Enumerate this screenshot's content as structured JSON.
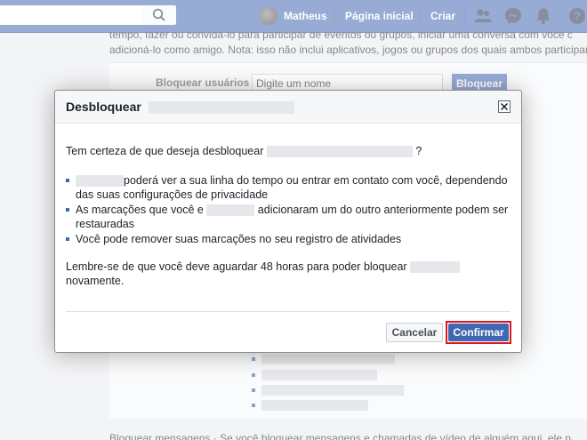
{
  "topbar": {
    "user_name": "Matheus",
    "home_label": "Página inicial",
    "create_label": "Criar"
  },
  "background": {
    "text_line_1": "tempo, fazer ou convidá-lo para participar de eventos ou grupos, iniciar uma conversa com você ou",
    "text_line_2": "adicioná-lo como amigo. Nota: isso não inclui aplicativos, jogos ou grupos dos quais ambos participam.",
    "block_users_label": "Bloquear usuários",
    "block_input_placeholder": "Digite um nome",
    "block_button_label": "Bloquear",
    "bottom_text": "Bloquear mensagens · Se você bloquear mensagens e chamadas de vídeo de alguém aqui, ele não poderá"
  },
  "dialog": {
    "title": "Desbloquear",
    "question": "Tem certeza de que deseja desbloquear",
    "question_end": "?",
    "items": [
      {
        "text": "poderá ver a sua linha do tempo ou entrar em contato com você, dependendo das suas configurações de privacidade"
      },
      {
        "before": "As marcações que você e",
        "after": "adicionaram um do outro anteriormente podem ser restauradas"
      },
      {
        "text": "Você pode remover suas marcações no seu registro de atividades"
      }
    ],
    "reminder_before": "Lembre-se de que você deve aguardar 48 horas para poder bloquear",
    "reminder_after": "novamente.",
    "cancel_label": "Cancelar",
    "confirm_label": "Confirmar"
  },
  "colors": {
    "brand": "#4267b2",
    "highlight": "#e0161d"
  }
}
